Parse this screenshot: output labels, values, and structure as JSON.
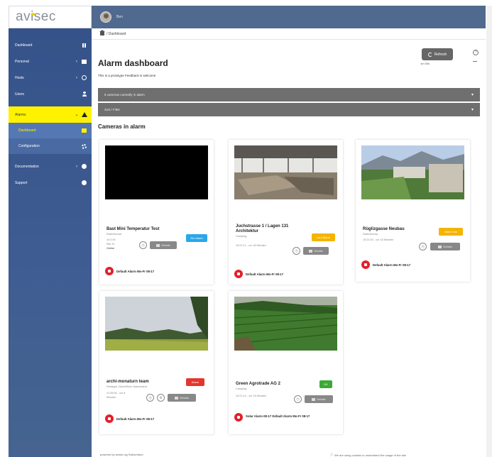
{
  "logo": "avisec",
  "user": {
    "name": "Ben"
  },
  "sidebar": {
    "items": [
      {
        "label": "Dashboard",
        "icon": "grid-icon",
        "has_arrow": false
      },
      {
        "label": "Personal",
        "icon": "square-icon",
        "has_arrow": true
      },
      {
        "label": "Hosts",
        "icon": "clock-icon",
        "has_arrow": true
      },
      {
        "label": "Users",
        "icon": "person-icon",
        "has_arrow": false
      },
      {
        "label": "Alarms",
        "icon": "warning-icon",
        "has_arrow": true,
        "active": true
      },
      {
        "label": "Dashboard",
        "icon": "doc-icon",
        "sub": true,
        "current": true
      },
      {
        "label": "Configuration",
        "icon": "gear-icon",
        "sub": true
      },
      {
        "label": "Documentation",
        "icon": "dot-icon",
        "has_arrow": true
      },
      {
        "label": "Support",
        "icon": "dot-icon",
        "has_arrow": false
      }
    ]
  },
  "breadcrumb": "/ Dashboard",
  "page": {
    "title": "Alarm dashboard",
    "subtitle": "This is a prototype Feedback is welcome",
    "refresh_label": "Refresh",
    "refresh_sub": "1m 00s",
    "help": "?"
  },
  "bars": [
    {
      "label": "5 cameras currently in alarm"
    },
    {
      "label": "Sort / Filter"
    }
  ],
  "section_title": "Cameras in alarm",
  "cameras": [
    {
      "name": "Bast Mini Temperatur Test",
      "sub": [
        "Switchhouse",
        "10:2:00",
        "Site 11",
        "Online"
      ],
      "badge": "Ein Alarm",
      "badge_color": "#2aa7ea",
      "btn": "Details",
      "alarm": "Default Alarm Mo-Fr 08-17",
      "thumb": "black"
    },
    {
      "name": "Juchstrasse 1 / Lagen 131 Architektur",
      "sub": [
        "Camping",
        "10:21:11 - vor 18 Minuten"
      ],
      "badge": "Lauf Alarm",
      "badge_color": "#f4b400",
      "btn": "Details",
      "alarm": "Default Alarm Mo-Fr 08-17",
      "thumb": "interior"
    },
    {
      "name": "Rüglizgasse Neubau",
      "sub": [
        "Switchhouse",
        "10:21:00 - vor 18 Minuten"
      ],
      "badge": "Alarm aus",
      "badge_color": "#f4b400",
      "btn": "Details",
      "alarm": "Default Alarm Mo-Fr 08-17",
      "thumb": "town"
    },
    {
      "name": "archi-monaturn team",
      "sub": [
        "Fieldtype Zürich/Bern Switzerland",
        "11:05:08 - vor 8",
        "Minuten"
      ],
      "badge": "Alarm",
      "badge_color": "#e4362e",
      "btn": "Details",
      "alarm": "Default Alarm Mo-Fr 08-17",
      "thumb": "field"
    },
    {
      "name": "Green Agrotrade AG 2",
      "sub": [
        "Camping",
        "10:21:14 - vor 18 Minuten"
      ],
      "badge": "OK",
      "badge_color": "#3aaa35",
      "btn": "Details",
      "alarm": "Solar Alarm 08-17 Default Alarm Mo-Fr 08-17",
      "thumb": "crops"
    }
  ],
  "footer": {
    "left": "powered by avisec ag Switzerland",
    "right": "We are using cookies to understand the usage of the site"
  },
  "colors": {
    "sidebar": "#3f5d92",
    "topbar": "#50698f",
    "active": "#fff200",
    "bar": "#6f6f6f",
    "alarm": "#e2202b"
  }
}
